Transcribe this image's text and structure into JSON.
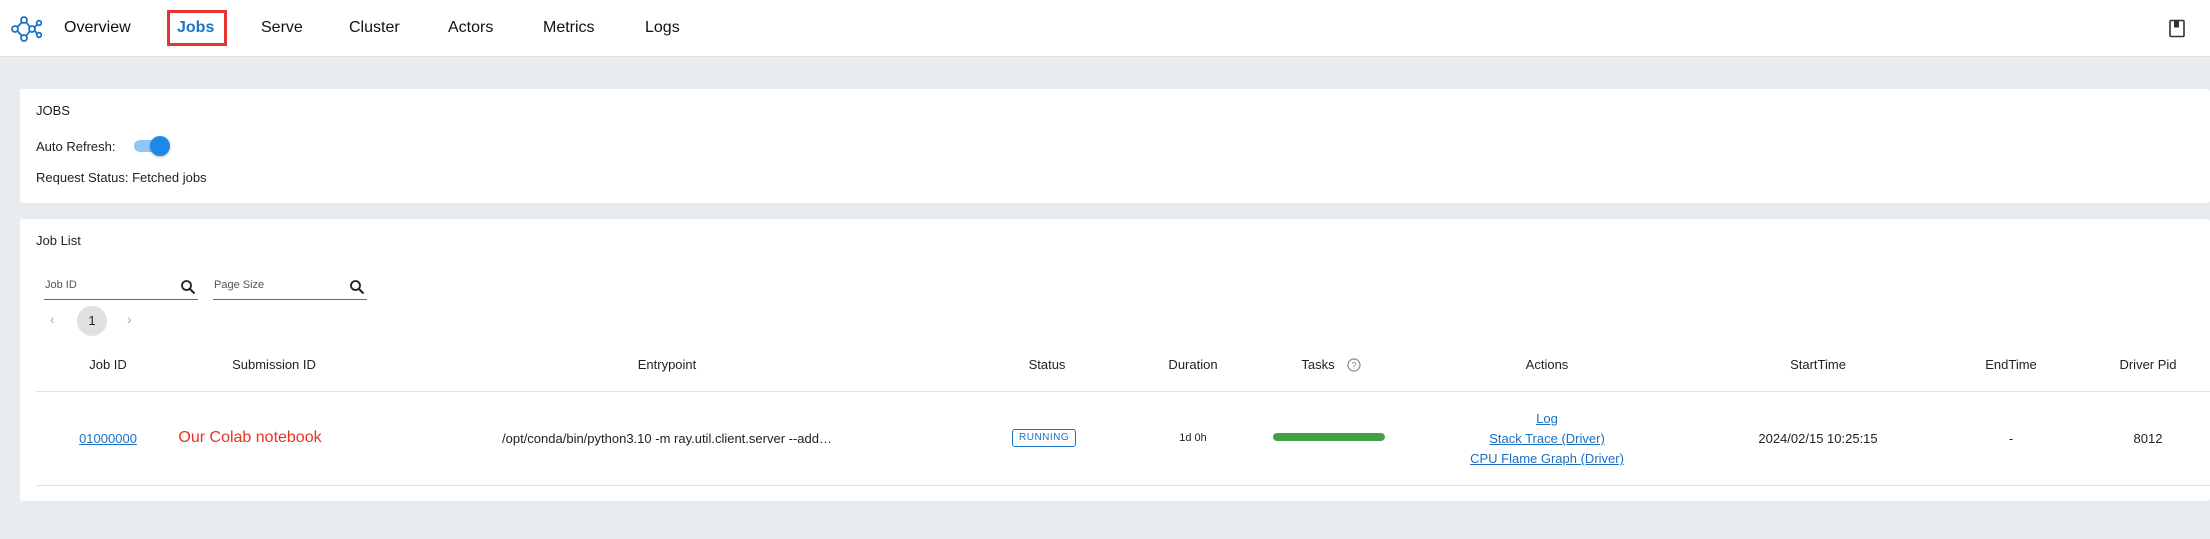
{
  "nav": {
    "items": [
      "Overview",
      "Jobs",
      "Serve",
      "Cluster",
      "Actors",
      "Metrics",
      "Logs"
    ],
    "active": "Jobs"
  },
  "jobs_card": {
    "title": "JOBS",
    "auto_refresh_label": "Auto Refresh:",
    "auto_refresh_on": true,
    "request_status": "Request Status: Fetched jobs"
  },
  "job_list": {
    "title": "Job List",
    "job_id_placeholder": "Job ID",
    "page_size_placeholder": "Page Size",
    "pager": {
      "prev": "‹",
      "page": "1",
      "next": "›"
    },
    "columns": [
      "Job ID",
      "Submission ID",
      "Entrypoint",
      "Status",
      "Duration",
      "Tasks",
      "Actions",
      "StartTime",
      "EndTime",
      "Driver Pid"
    ],
    "row": {
      "job_id": "01000000",
      "submission_id": "Our Colab notebook",
      "entrypoint": "/opt/conda/bin/python3.10 -m ray.util.client.server --add…",
      "status": "RUNNING",
      "duration": "1d 0h",
      "tasks_progress": 1.0,
      "actions": [
        "Log",
        "Stack Trace (Driver)",
        "CPU Flame Graph (Driver)"
      ],
      "start_time": "2024/02/15 10:25:15",
      "end_time": "-",
      "driver_pid": "8012"
    }
  },
  "colors": {
    "accent": "#1a73c9",
    "highlight_box": "#e3342f",
    "progress": "#43a047"
  }
}
